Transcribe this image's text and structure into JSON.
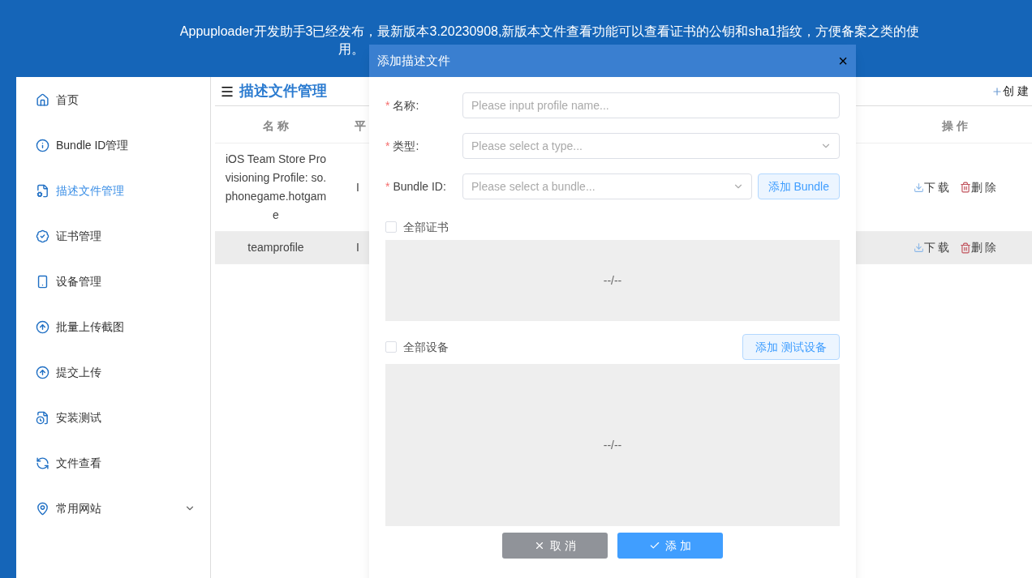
{
  "banner": {
    "lines": [
      "Appuploader开发助手3已经发布，最新版本3.20230908,新版本文件查看功能可以查看证书的公钥和sha1指纹，方便备案之类的使",
      "用。"
    ]
  },
  "sidebar": {
    "items": [
      {
        "label": "首页",
        "selected": false
      },
      {
        "label": "Bundle ID管理",
        "selected": false
      },
      {
        "label": "描述文件管理",
        "selected": true
      },
      {
        "label": "证书管理",
        "selected": false
      },
      {
        "label": "设备管理",
        "selected": false
      },
      {
        "label": "批量上传截图",
        "selected": false
      },
      {
        "label": "提交上传",
        "selected": false
      },
      {
        "label": "安装测试",
        "selected": false
      },
      {
        "label": "文件查看",
        "selected": false
      },
      {
        "label": "常用网站",
        "selected": false,
        "expanded": false
      }
    ]
  },
  "main": {
    "title": "描述文件管理",
    "create_button": "创 建",
    "table": {
      "columns": [
        "名 称",
        "平",
        "操 作"
      ],
      "rows": [
        {
          "name": "iOS Team Store Provisioning Profile: so.phonegame.hotgame",
          "platform": "I",
          "actions": [
            "下 载",
            "删 除"
          ],
          "selected": false
        },
        {
          "name": "teamprofile",
          "platform": "I",
          "actions": [
            "下 载",
            "删 除"
          ],
          "selected": true
        }
      ]
    }
  },
  "dialog": {
    "title": "添加描述文件",
    "close": "×",
    "required_mark": "*",
    "fields": [
      {
        "kind": "input",
        "label": "名称:",
        "required": true,
        "placeholder": "Please input profile name..."
      },
      {
        "kind": "select",
        "label": "类型:",
        "required": true,
        "placeholder": "Please select a type..."
      },
      {
        "kind": "select",
        "label": "Bundle ID:",
        "required": true,
        "placeholder": "Please select a bundle...",
        "button": "添加 Bundle"
      }
    ],
    "groups": [
      {
        "label": "全部证书",
        "checked": false,
        "empty": "--/--"
      },
      {
        "label": "全部设备",
        "checked": false,
        "empty": "--/--",
        "button": "添加 测试设备"
      }
    ],
    "cancel": "取 消",
    "submit": "添 加"
  }
}
